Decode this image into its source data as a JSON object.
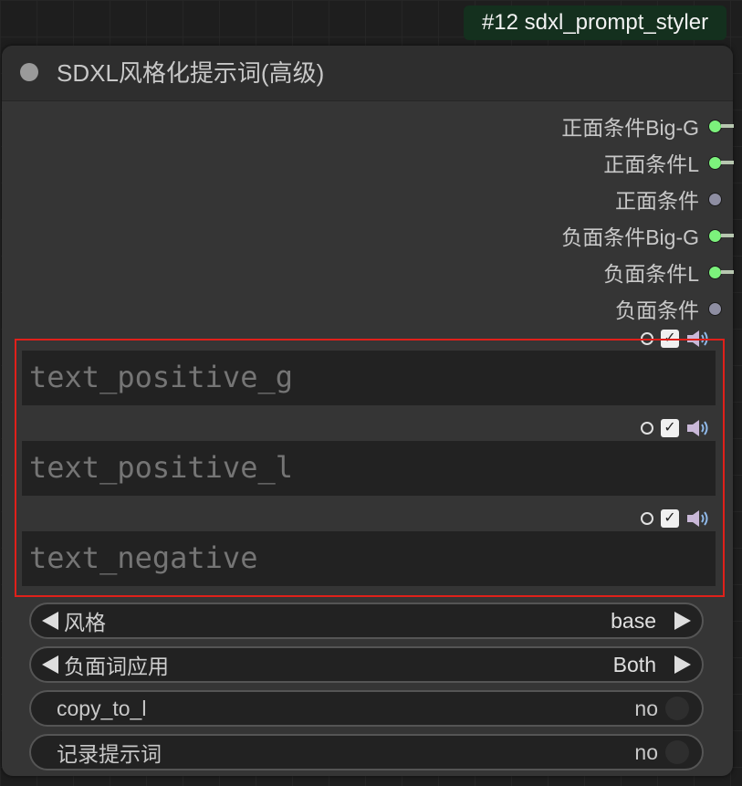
{
  "node_badge": "#12 sdxl_prompt_styler",
  "node_title": "SDXL风格化提示词(高级)",
  "outputs": [
    {
      "label": "正面条件Big-G",
      "connected": true
    },
    {
      "label": "正面条件L",
      "connected": true
    },
    {
      "label": "正面条件",
      "connected": false
    },
    {
      "label": "负面条件Big-G",
      "connected": true
    },
    {
      "label": "负面条件L",
      "connected": true
    },
    {
      "label": "负面条件",
      "connected": false
    }
  ],
  "text_widgets": [
    {
      "placeholder": "text_positive_g"
    },
    {
      "placeholder": "text_positive_l"
    },
    {
      "placeholder": "text_negative"
    }
  ],
  "combos": [
    {
      "label": "风格",
      "value": "base"
    },
    {
      "label": "负面词应用",
      "value": "Both"
    }
  ],
  "toggles": [
    {
      "label": "copy_to_l",
      "value": "no"
    },
    {
      "label": "记录提示词",
      "value": "no"
    }
  ],
  "colors": {
    "connected_slot": "#7cf27c",
    "disconnected_slot": "#8e8ea2",
    "badge_bg": "#14301e",
    "highlight": "#e0201a"
  }
}
